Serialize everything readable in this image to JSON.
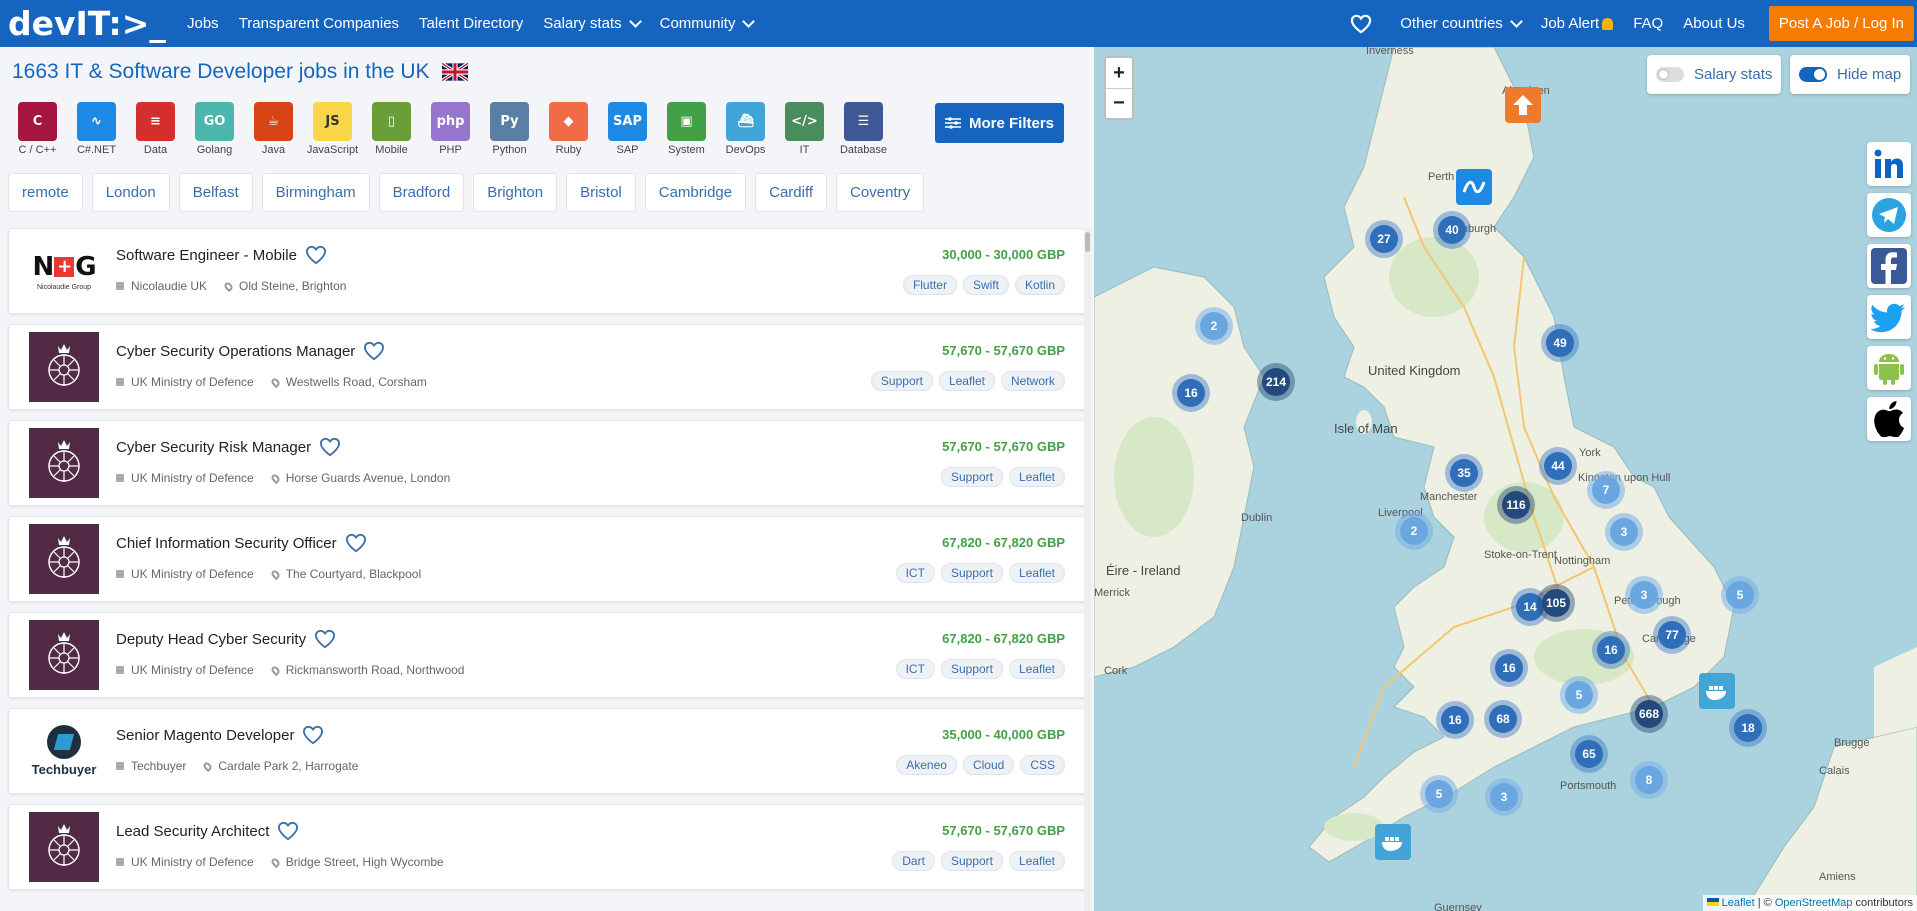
{
  "nav": {
    "logo": "devIT:>_",
    "items": [
      "Jobs",
      "Transparent Companies",
      "Talent Directory",
      "Salary stats",
      "Community"
    ],
    "other_countries": "Other countries",
    "job_alert": "Job Alert",
    "faq": "FAQ",
    "about": "About Us",
    "post_job": "Post A Job / Log In"
  },
  "page": {
    "title": "1663 IT & Software Developer jobs in the UK"
  },
  "tech_filters": [
    {
      "label": "C / C++",
      "icon": "c-icon",
      "color": "#a4163f",
      "glyph": "C"
    },
    {
      "label": "C#.NET",
      "icon": "dotnet-icon",
      "color": "#1e88e5",
      "glyph": "∿"
    },
    {
      "label": "Data",
      "icon": "data-icon",
      "color": "#d32f2f",
      "glyph": "≡"
    },
    {
      "label": "Golang",
      "icon": "golang-icon",
      "color": "#4db6ac",
      "glyph": "GO"
    },
    {
      "label": "Java",
      "icon": "java-icon",
      "color": "#d84315",
      "glyph": "☕"
    },
    {
      "label": "JavaScript",
      "icon": "javascript-icon",
      "color": "#f9d648",
      "glyph": "JS"
    },
    {
      "label": "Mobile",
      "icon": "mobile-icon",
      "color": "#689f38",
      "glyph": "▯"
    },
    {
      "label": "PHP",
      "icon": "php-icon",
      "color": "#9575cd",
      "glyph": "php"
    },
    {
      "label": "Python",
      "icon": "python-icon",
      "color": "#5a7ea5",
      "glyph": "Py"
    },
    {
      "label": "Ruby",
      "icon": "ruby-icon",
      "color": "#ef6c47",
      "glyph": "◆"
    },
    {
      "label": "SAP",
      "icon": "sap-icon",
      "color": "#1e88e5",
      "glyph": "SAP"
    },
    {
      "label": "System",
      "icon": "system-icon",
      "color": "#43a047",
      "glyph": "▣"
    },
    {
      "label": "DevOps",
      "icon": "devops-icon",
      "color": "#42a5d5",
      "glyph": "⛴"
    },
    {
      "label": "IT",
      "icon": "it-icon",
      "color": "#4a8c5c",
      "glyph": "</>"
    },
    {
      "label": "Database",
      "icon": "database-icon",
      "color": "#3f5896",
      "glyph": "☰"
    }
  ],
  "more_filters": "More Filters",
  "cities": [
    "remote",
    "London",
    "Belfast",
    "Birmingham",
    "Bradford",
    "Brighton",
    "Bristol",
    "Cambridge",
    "Cardiff",
    "Coventry"
  ],
  "jobs": [
    {
      "title": "Software Engineer - Mobile",
      "company": "Nicolaudie UK",
      "location": "Old Steine, Brighton",
      "salary": "30,000 - 30,000 GBP",
      "tags": [
        "Flutter",
        "Swift",
        "Kotlin"
      ],
      "logo": "nicolaudie"
    },
    {
      "title": "Cyber Security Operations Manager",
      "company": "UK Ministry of Defence",
      "location": "Westwells Road, Corsham",
      "salary": "57,670 - 57,670 GBP",
      "tags": [
        "Support",
        "Leaflet",
        "Network"
      ],
      "logo": "mod"
    },
    {
      "title": "Cyber Security Risk Manager",
      "company": "UK Ministry of Defence",
      "location": "Horse Guards Avenue, London",
      "salary": "57,670 - 57,670 GBP",
      "tags": [
        "Support",
        "Leaflet"
      ],
      "logo": "mod"
    },
    {
      "title": "Chief Information Security Officer",
      "company": "UK Ministry of Defence",
      "location": "The Courtyard, Blackpool",
      "salary": "67,820 - 67,820 GBP",
      "tags": [
        "ICT",
        "Support",
        "Leaflet"
      ],
      "logo": "mod"
    },
    {
      "title": "Deputy Head Cyber Security",
      "company": "UK Ministry of Defence",
      "location": "Rickmansworth Road, Northwood",
      "salary": "67,820 - 67,820 GBP",
      "tags": [
        "ICT",
        "Support",
        "Leaflet"
      ],
      "logo": "mod"
    },
    {
      "title": "Senior Magento Developer",
      "company": "Techbuyer",
      "location": "Cardale Park 2, Harrogate",
      "salary": "35,000 - 40,000 GBP",
      "tags": [
        "Akeneo",
        "Cloud",
        "CSS"
      ],
      "logo": "techbuyer"
    },
    {
      "title": "Lead Security Architect",
      "company": "UK Ministry of Defence",
      "location": "Bridge Street, High Wycombe",
      "salary": "57,670 - 57,670 GBP",
      "tags": [
        "Dart",
        "Support",
        "Leaflet"
      ],
      "logo": "mod"
    }
  ],
  "logos": {
    "nicolaudie_text": "N+G",
    "nicolaudie_sub": "Nicolaudie Group",
    "techbuyer_text": "Techbuyer"
  },
  "map": {
    "salary_stats": "Salary stats",
    "hide_map": "Hide map",
    "zoom_in": "+",
    "zoom_out": "−",
    "labels": [
      "Inverness",
      "Aberdeen",
      "Perth",
      "Edinburgh",
      "United Kingdom",
      "Isle of Man",
      "York",
      "Kingston upon Hull",
      "Liverpool",
      "Manchester",
      "Dublin",
      "Éire - Ireland",
      "Merrick",
      "Stoke-on-Trent",
      "Nottingham",
      "Peterborough",
      "Cambridge",
      "Cork",
      "Portsmouth",
      "Brugge",
      "Calais",
      "Amiens",
      "Guernsey"
    ],
    "clusters": [
      "27",
      "40",
      "2",
      "214",
      "16",
      "49",
      "35",
      "44",
      "7",
      "116",
      "2",
      "3",
      "3",
      "5",
      "14",
      "105",
      "77",
      "16",
      "16",
      "5",
      "668",
      "18",
      "16",
      "68",
      "65",
      "8",
      "5",
      "3"
    ],
    "attribution_leaflet": "Leaflet",
    "attribution_rest": " | © ",
    "attribution_osm": "OpenStreetMap",
    "attribution_contrib": " contributors"
  },
  "social": [
    "linkedin-icon",
    "telegram-icon",
    "facebook-icon",
    "twitter-icon",
    "android-icon",
    "apple-icon"
  ]
}
